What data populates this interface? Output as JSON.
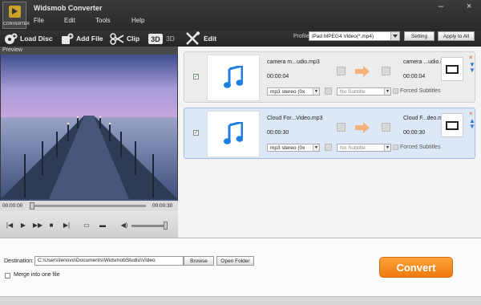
{
  "app": {
    "title": "Widsmob Converter",
    "logo_text": "CONVERTER"
  },
  "menu": [
    "File",
    "Edit",
    "Tools",
    "Help"
  ],
  "window_controls": {
    "minimize": "–",
    "close": "×"
  },
  "toolbar": {
    "load_disc": "Load Disc",
    "add_file": "Add File",
    "clip": "Clip",
    "three_d": "3D",
    "edit": "Edit",
    "profile_label": "Profile:",
    "profile_value": "iPad MPEG4 Video(*.mp4)",
    "setting": "Setting",
    "apply_all": "Apply to All"
  },
  "preview": {
    "heading": "Preview",
    "time_start": "00:00:00",
    "time_end": "00:00:30",
    "progress": 0.0,
    "volume": 0.9
  },
  "files": [
    {
      "checked": true,
      "source_name": "camera m...udio.mp3",
      "source_duration": "00:00:04",
      "output_name": "camera ...udio.mp3",
      "output_duration": "00:00:04",
      "audio_track": "mp3 stereo (0x",
      "subtitle": "No Subtitle",
      "forced_subtitles": "Forced Subtitles",
      "selected": false
    },
    {
      "checked": true,
      "source_name": "Cloud For...Video.mp3",
      "source_duration": "00:00:30",
      "output_name": "Cloud F...deo.mp3",
      "output_duration": "00:00:30",
      "audio_track": "mp3 stereo (0x",
      "subtitle": "No Subtitle",
      "forced_subtitles": "Forced Subtitles",
      "selected": true
    }
  ],
  "bottom": {
    "destination_label": "Destination:",
    "destination_path": "C:\\Users\\lenovo\\Documents\\WidsmobStudio\\Video",
    "browse": "Browse",
    "open_folder": "Open Folder",
    "merge_label": "Merge into one file",
    "merge_checked": false,
    "convert": "Convert"
  },
  "colors": {
    "accent_orange": "#f28a1e",
    "music_blue": "#1f7fe0",
    "selected_row": "#dde8f7"
  }
}
